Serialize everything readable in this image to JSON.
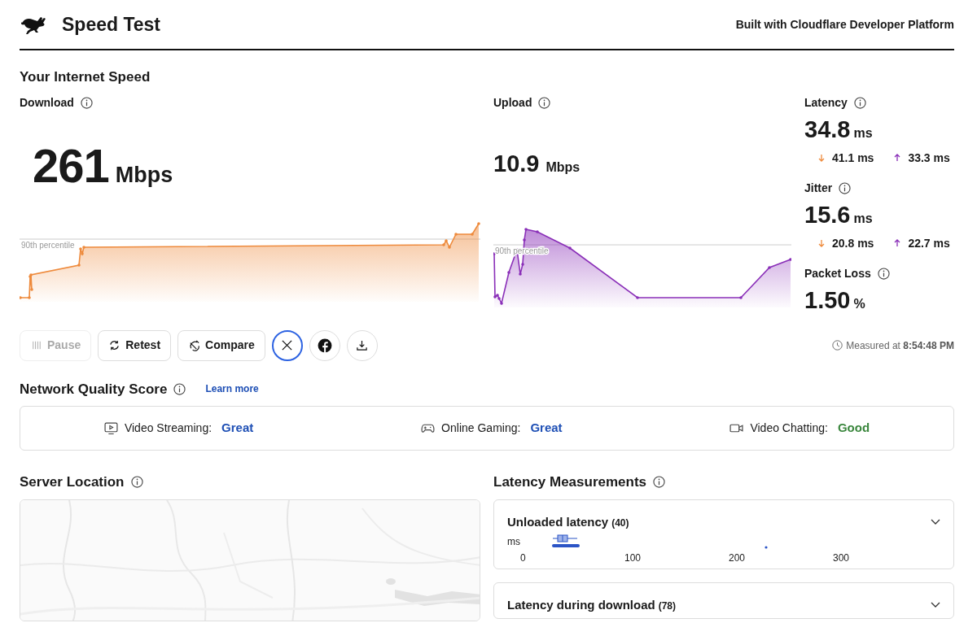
{
  "header": {
    "title": "Speed Test",
    "tagline": "Built with Cloudflare Developer Platform"
  },
  "section_title": "Your Internet Speed",
  "download": {
    "label": "Download",
    "value": "261",
    "unit": "Mbps",
    "percentile_label": "90th percentile"
  },
  "upload": {
    "label": "Upload",
    "value": "10.9",
    "unit": "Mbps",
    "percentile_label": "90th percentile"
  },
  "metrics": [
    {
      "label": "Latency",
      "value": "34.8",
      "unit": "ms",
      "down": "41.1 ms",
      "up": "33.3 ms"
    },
    {
      "label": "Jitter",
      "value": "15.6",
      "unit": "ms",
      "down": "20.8 ms",
      "up": "22.7 ms"
    },
    {
      "label": "Packet Loss",
      "value": "1.50",
      "unit": "%"
    }
  ],
  "actions": [
    {
      "kind": "pause",
      "label": "Pause",
      "disabled": true,
      "focused": false
    },
    {
      "kind": "retest",
      "label": "Retest",
      "disabled": false,
      "focused": false
    },
    {
      "kind": "compare",
      "label": "Compare",
      "disabled": false,
      "focused": false
    },
    {
      "kind": "x",
      "disabled": false,
      "focused": true
    },
    {
      "kind": "facebook",
      "disabled": false,
      "focused": false
    },
    {
      "kind": "download",
      "disabled": false,
      "focused": false
    }
  ],
  "measured": "Measured at **8:54:48 PM**",
  "quality": {
    "title": "Network Quality Score",
    "link": "Learn more",
    "items": [
      {
        "kind": "video",
        "label": "Video Streaming:",
        "rating": "Great",
        "color": "#1e4fb5"
      },
      {
        "kind": "gaming",
        "label": "Online Gaming:",
        "rating": "Great",
        "color": "#1e4fb5"
      },
      {
        "kind": "camera",
        "label": "Video Chatting:",
        "rating": "Good",
        "color": "#3b873e"
      }
    ]
  },
  "server": {
    "title": "Server Location"
  },
  "latency_measurements": {
    "title": "Latency Measurements",
    "panels": [
      {
        "title": "Unloaded latency",
        "count": "(40)",
        "unit": "ms",
        "ticks": [
          "0",
          "100",
          "200",
          "300"
        ]
      },
      {
        "title": "Latency during download",
        "count": "(78)"
      }
    ]
  }
}
